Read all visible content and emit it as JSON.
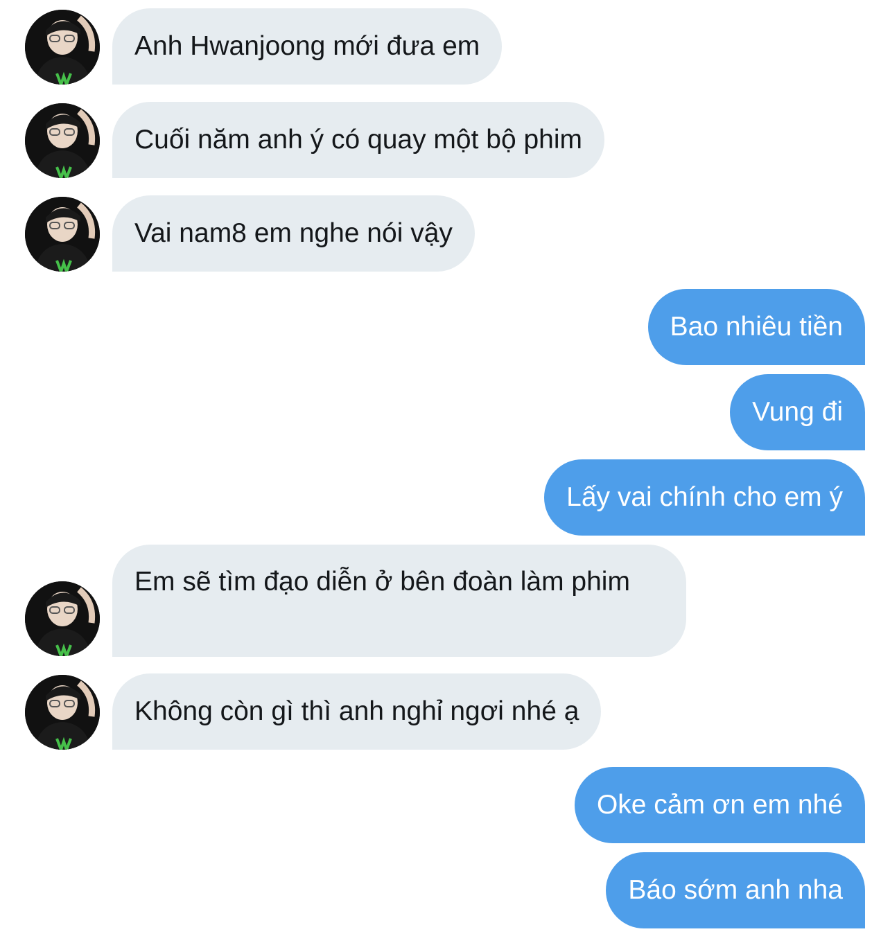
{
  "conversation": {
    "messages": [
      {
        "sender": "contact",
        "text": "Anh Hwanjoong mới đưa em"
      },
      {
        "sender": "contact",
        "text": "Cuối năm anh ý có quay một bộ phim"
      },
      {
        "sender": "contact",
        "text": "Vai nam8 em nghe nói vậy"
      },
      {
        "sender": "me",
        "text": "Bao nhiêu tiền"
      },
      {
        "sender": "me",
        "text": "Vung đi"
      },
      {
        "sender": "me",
        "text": "Lấy vai chính cho em ý"
      },
      {
        "sender": "contact",
        "text": "Em sẽ tìm đạo diễn ở bên đoàn làm phim"
      },
      {
        "sender": "contact",
        "text": "Không còn gì thì anh nghỉ ngơi nhé ạ"
      },
      {
        "sender": "me",
        "text": "Oke cảm ơn em nhé"
      },
      {
        "sender": "me",
        "text": "Báo sớm anh nha"
      }
    ]
  },
  "colors": {
    "incoming_bubble": "#e6ecf0",
    "incoming_text": "#14171a",
    "outgoing_bubble": "#4e9eea",
    "outgoing_text": "#ffffff",
    "background": "#ffffff"
  },
  "icons": {
    "contact_avatar": "avatar-photo-icon"
  }
}
